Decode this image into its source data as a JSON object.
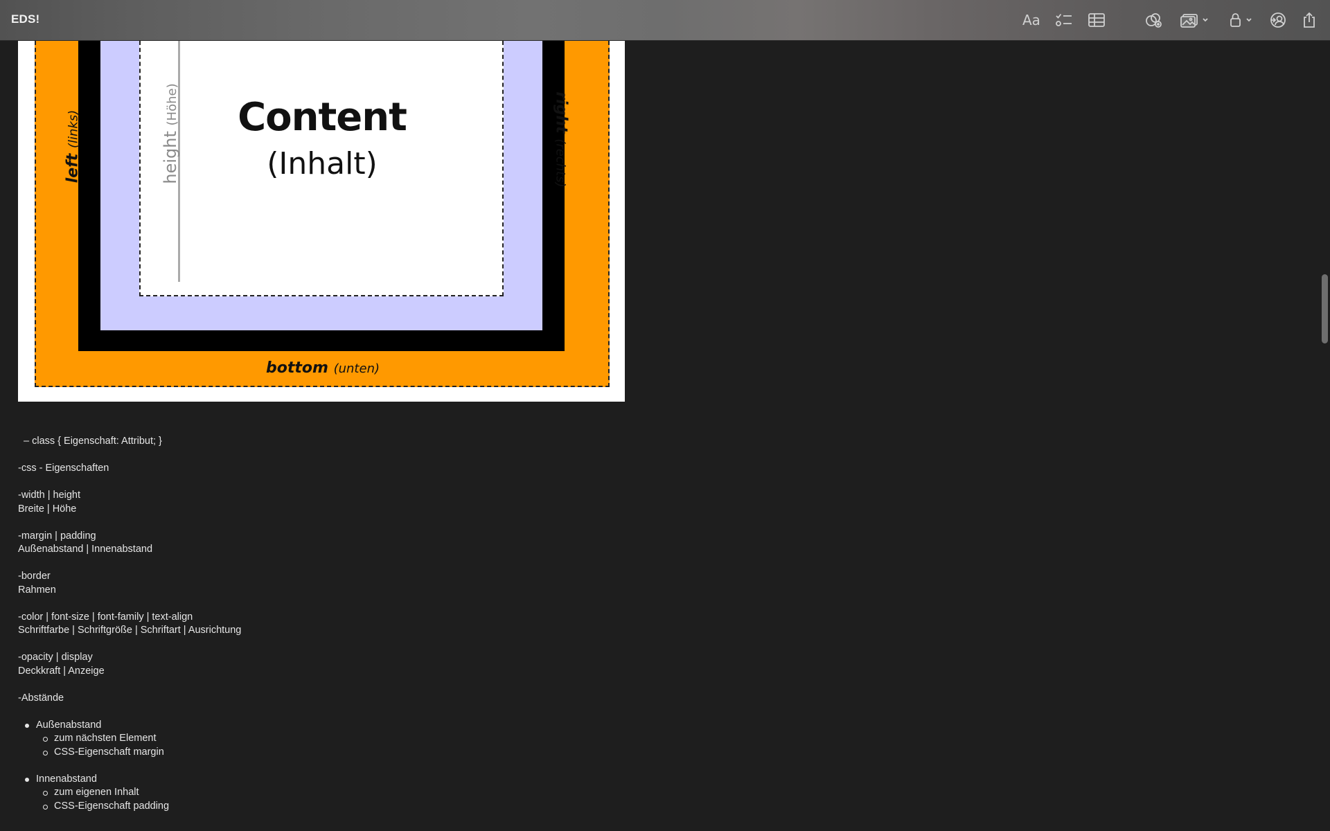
{
  "app": {
    "title": "EDS!"
  },
  "toolbar": {
    "icons": [
      "format-text-icon",
      "checklist-icon",
      "table-icon",
      "collaborate-link-icon",
      "media-icon",
      "lock-icon",
      "share-collaboration-icon",
      "share-icon"
    ],
    "format_label": "Aa"
  },
  "figure": {
    "content_title": "Content",
    "content_subtitle": "(Inhalt)",
    "left_label": "left",
    "left_sub": "(links)",
    "right_label": "right",
    "right_sub": "(rechts)",
    "bottom_label": "bottom",
    "bottom_sub": "(unten)",
    "height_label": "height",
    "height_sub": "(Höhe)",
    "colors": {
      "margin": "#ff9900",
      "border": "#000000",
      "padding": "#ccccff",
      "content": "#ffffff"
    }
  },
  "notes": {
    "dash_item": "–  class { Eigenschaft: Attribut; }",
    "css_heading": "-css - Eigenschaften",
    "width_line1": "-width | height",
    "width_line2": "Breite | Höhe",
    "margin_line1": "-margin | padding",
    "margin_line2": "Außenabstand | Innenabstand",
    "border_line1": "-border",
    "border_line2": "Rahmen",
    "color_line1": "-color | font-size | font-family | text-align",
    "color_line2": "Schriftfarbe | Schriftgröße | Schriftart | Ausrichtung",
    "opacity_line1": "-opacity | display",
    "opacity_line2": "Deckkraft | Anzeige",
    "abstaende": "-Abstände",
    "list": [
      {
        "label": "Außenabstand",
        "sub": [
          "zum nächsten Element",
          "CSS-Eigenschaft  margin"
        ]
      },
      {
        "label": "Innenabstand",
        "sub": [
          "zum eigenen Inhalt",
          "CSS-Eigenschaft  padding"
        ]
      }
    ]
  }
}
